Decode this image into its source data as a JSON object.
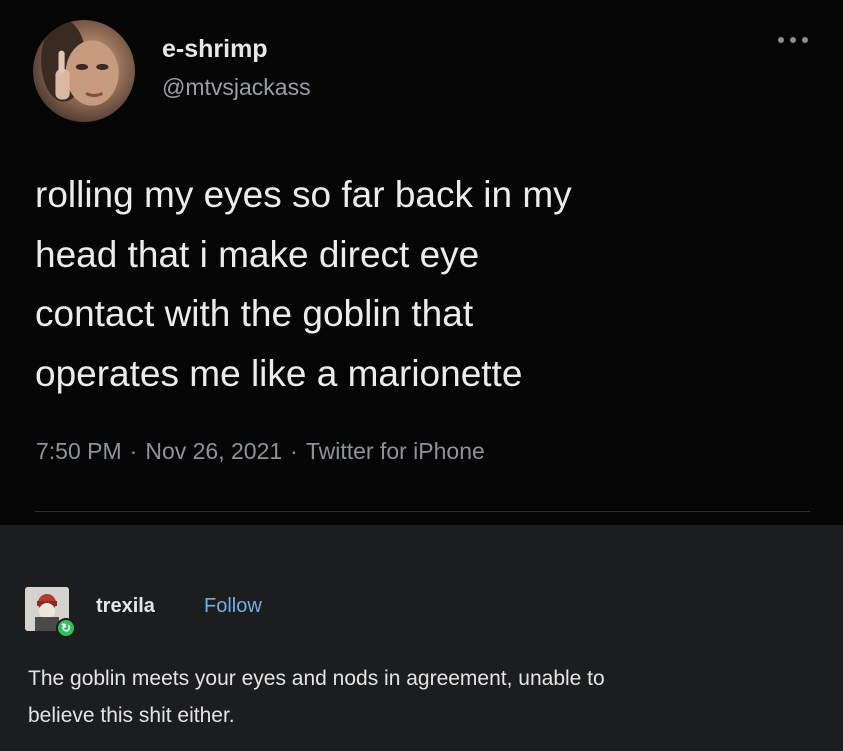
{
  "tweet": {
    "display_name": "e-shrimp",
    "handle": "@mtvsjackass",
    "text_lines": [
      "rolling my eyes so far back in my",
      "head that i make direct eye",
      "contact with the goblin that",
      "operates me like a marionette"
    ],
    "time": "7:50 PM",
    "date": "Nov 26, 2021",
    "client": "Twitter for iPhone",
    "separator": "·",
    "more_icon": "more-horizontal-icon"
  },
  "reply": {
    "username": "trexila",
    "follow_label": "Follow",
    "text_lines": [
      "The goblin meets your eyes and nods in agreement, unable to",
      "believe this shit either."
    ],
    "badge_icon": "refresh-icon",
    "accent_color": "#6eb0e6",
    "badge_color": "#2ec05a"
  }
}
